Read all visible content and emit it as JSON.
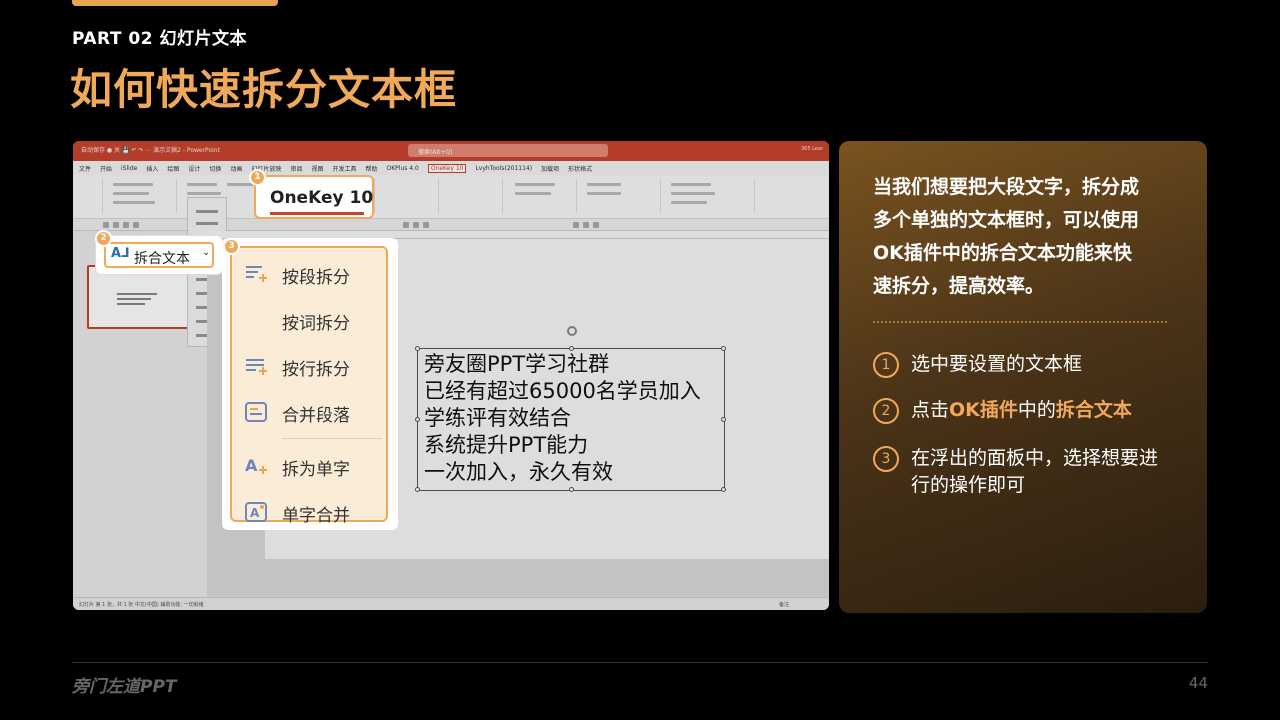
{
  "header": {
    "part_label": "PART 02  幻灯片文本",
    "title": "如何快速拆分文本框"
  },
  "app": {
    "titlebar_left": "自动保存 ● 关 💾 ↶ ↷ ⋯  演示文稿2 - PowerPoint",
    "search_placeholder": "搜索(Alt+Q)",
    "titlebar_right": "365 Lear",
    "menu": [
      "文件",
      "开始",
      "iSlide",
      "插入",
      "绘图",
      "设计",
      "切换",
      "动画",
      "幻灯片放映",
      "审阅",
      "视图",
      "开发工具",
      "帮助",
      "OKPlus 4.0",
      "OneKey 10",
      "LvyhTools(201114)",
      "加载项",
      "形状格式"
    ],
    "active_menu": "OneKey 10",
    "status_left": "幻灯片 第 1 张，共 1 张   中文(中国)   辅助功能: 一切就绪",
    "status_right": "备注"
  },
  "textbox": {
    "lines": [
      "旁友圈PPT学习社群",
      "已经有超过65000名学员加入",
      "学练评有效结合",
      "系统提升PPT能力",
      "一次加入，永久有效"
    ]
  },
  "callouts": {
    "onekey_label": "OneKey 10",
    "split_button_label": "拆合文本",
    "split_icon": "A⅃",
    "badges": [
      "1",
      "2",
      "3"
    ],
    "panel_items": [
      {
        "icon": "split-paragraph-icon",
        "label": "按段拆分"
      },
      {
        "icon": "split-word-icon",
        "label": "按词拆分"
      },
      {
        "icon": "split-line-icon",
        "label": "按行拆分"
      },
      {
        "icon": "merge-paragraph-icon",
        "label": "合并段落"
      },
      {
        "icon": "split-char-icon",
        "label": "拆为单字"
      },
      {
        "icon": "merge-char-icon",
        "label": "单字合并"
      }
    ]
  },
  "card": {
    "paragraph": [
      "当我们想要把大段文字，拆分成",
      "多个单独的文本框时，可以使用",
      "OK插件中的拆合文本功能来快",
      "速拆分，提高效率。"
    ],
    "steps": [
      {
        "num": "1",
        "text": "选中要设置的文本框"
      },
      {
        "num": "2",
        "pre": "点击",
        "hl1": "OK插件",
        "mid": "中的",
        "hl2": "拆合文本"
      },
      {
        "num": "3",
        "line1": "在浮出的面板中，选择想要进",
        "line2": "行的操作即可"
      }
    ]
  },
  "footer": {
    "logo": "旁门左道PPT",
    "page": "44"
  },
  "colors": {
    "accent": "#f0a95a",
    "office_red": "#c9432f",
    "background": "#000000"
  }
}
